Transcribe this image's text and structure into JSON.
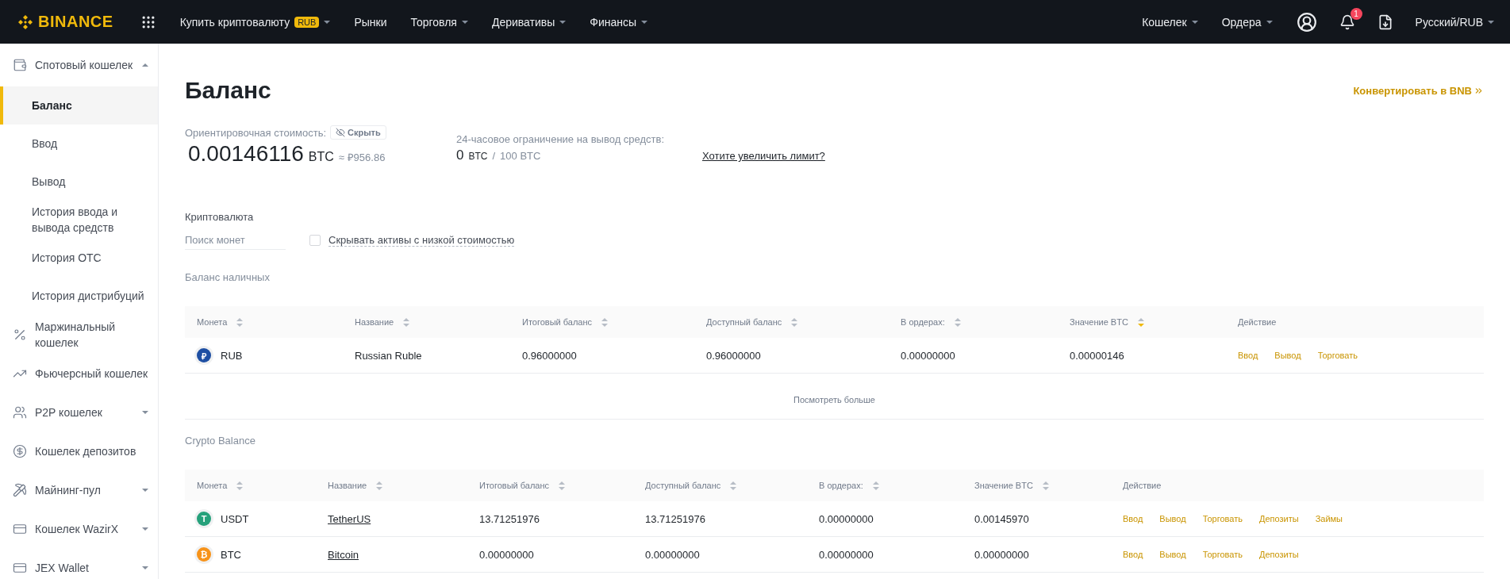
{
  "topbar": {
    "logo": "BINANCE",
    "nav": [
      {
        "label": "Купить криптовалюту",
        "badge": "RUB",
        "dropdown": true
      },
      {
        "label": "Рынки",
        "dropdown": false
      },
      {
        "label": "Торговля",
        "dropdown": true
      },
      {
        "label": "Деривативы",
        "dropdown": true
      },
      {
        "label": "Финансы",
        "dropdown": true
      }
    ],
    "right_nav": [
      {
        "label": "Кошелек",
        "dropdown": true
      },
      {
        "label": "Ордера",
        "dropdown": true
      }
    ],
    "notifications": "1",
    "language": "Русский/RUB"
  },
  "sidebar": {
    "items": [
      {
        "label": "Спотовый кошелек",
        "selected": false,
        "expanded": true,
        "children": [
          {
            "label": "Баланс",
            "selected": true
          },
          {
            "label": "Ввод",
            "selected": false
          },
          {
            "label": "Вывод",
            "selected": false
          },
          {
            "label": "История ввода и вывода средств",
            "selected": false
          },
          {
            "label": "История OTC",
            "selected": false
          },
          {
            "label": "История дистрибуций",
            "selected": false
          }
        ]
      },
      {
        "label": "Маржинальный кошелек",
        "selected": false
      },
      {
        "label": "Фьючерсный кошелек",
        "selected": false
      },
      {
        "label": "P2P кошелек",
        "selected": false,
        "expanded": false
      },
      {
        "label": "Кошелек депозитов",
        "selected": false
      },
      {
        "label": "Майнинг-пул",
        "selected": false,
        "expanded": false
      },
      {
        "label": "Кошелек WazirX",
        "selected": false,
        "expanded": false
      },
      {
        "label": "JEX Wallet",
        "selected": false,
        "expanded": false
      }
    ]
  },
  "page": {
    "title": "Баланс",
    "convert_link": "Конвертировать в BNB",
    "estimate": {
      "label": "Ориентировочная стоимость:",
      "hide_button": "Скрыть",
      "amount": "0.00146116",
      "unit": "BTC",
      "approx": "≈ ₽956.86"
    },
    "limit": {
      "label": "24-часовое ограничение на вывод средств:",
      "used": "0",
      "used_unit": "BTC",
      "separator": "/",
      "total": "100 BTC",
      "link": "Хотите увеличить лимит?"
    },
    "filters": {
      "label": "Криптовалюта",
      "search": {
        "placeholder": "Поиск монет"
      },
      "hide_small": {
        "label": "Скрывать активы с низкой стоимостью",
        "checked": false
      }
    }
  },
  "tables": [
    {
      "title": "Баланс наличных",
      "columns": [
        {
          "label": "Монета",
          "sorted": false
        },
        {
          "label": "Название",
          "sorted": false
        },
        {
          "label": "Итоговый баланс",
          "sorted": false
        },
        {
          "label": "Доступный баланс",
          "sorted": false
        },
        {
          "label": "В ордерах:",
          "sorted": false
        },
        {
          "label": "Значение BTC",
          "sorted": true
        },
        {
          "label": "Действие"
        }
      ],
      "rows": [
        {
          "coin": "RUB",
          "symbol": "₽",
          "color": "#1e4fa3",
          "name": "Russian Ruble",
          "name_link": false,
          "total": "0.96000000",
          "available": "0.96000000",
          "in_orders": "0.00000000",
          "btc_value": "0.00000146",
          "actions": [
            "Ввод",
            "Вывод",
            "Торговать"
          ]
        }
      ],
      "more": "Посмотреть больше"
    },
    {
      "title": "Crypto Balance",
      "columns": [
        {
          "label": "Монета",
          "sorted": false
        },
        {
          "label": "Название",
          "sorted": false
        },
        {
          "label": "Итоговый баланс",
          "sorted": false
        },
        {
          "label": "Доступный баланс",
          "sorted": false
        },
        {
          "label": "В ордерах:",
          "sorted": false
        },
        {
          "label": "Значение BTC",
          "sorted": false
        },
        {
          "label": "Действие"
        }
      ],
      "rows": [
        {
          "coin": "USDT",
          "symbol": "T",
          "color": "#26a17b",
          "name": "TetherUS",
          "name_link": true,
          "total": "13.71251976",
          "available": "13.71251976",
          "in_orders": "0.00000000",
          "btc_value": "0.00145970",
          "actions": [
            "Ввод",
            "Вывод",
            "Торговать",
            "Депозиты",
            "Займы"
          ]
        },
        {
          "coin": "BTC",
          "symbol": "₿",
          "color": "#f7931a",
          "name": "Bitcoin",
          "name_link": true,
          "total": "0.00000000",
          "available": "0.00000000",
          "in_orders": "0.00000000",
          "btc_value": "0.00000000",
          "actions": [
            "Ввод",
            "Вывод",
            "Торговать",
            "Депозиты"
          ]
        }
      ]
    }
  ]
}
